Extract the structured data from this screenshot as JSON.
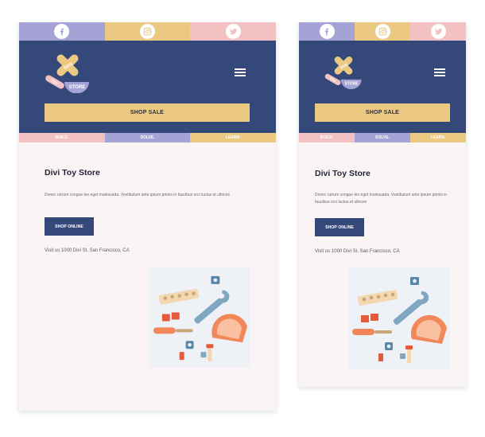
{
  "colors": {
    "navy": "#34497a",
    "lavender": "#a5a3d6",
    "mustard": "#ebc982",
    "pink": "#f2c2c3",
    "page_bg": "#faf4f4"
  },
  "social": [
    {
      "name": "facebook-icon",
      "glyph": "f"
    },
    {
      "name": "instagram-icon",
      "glyph": ""
    },
    {
      "name": "twitter-icon",
      "glyph": ""
    }
  ],
  "logo": {
    "word_divi": "DIVI",
    "word_toy": "TOY",
    "word_store": "STORE"
  },
  "header": {
    "sale_label": "SHOP SALE"
  },
  "tags": [
    "BUILD.",
    "SOLVE.",
    "LEARN."
  ],
  "content": {
    "title": "Divi Toy Store",
    "description": "Donec rutrum congue leo eget malesuada. Vestibulum ante ipsum primis in faucibus orci luctus et ultrices",
    "shop_label": "SHOP ONLINE",
    "address": "Visit us 1000 Divi St. San Francisco, CA"
  }
}
